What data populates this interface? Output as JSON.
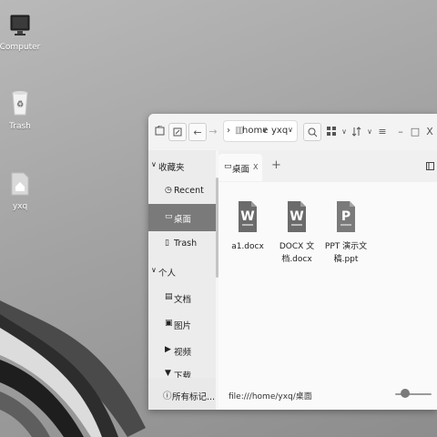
{
  "desktop": {
    "icons": [
      {
        "label": "Computer",
        "icon": "computer-icon"
      },
      {
        "label": "Trash",
        "icon": "trash-icon"
      },
      {
        "label": "yxq",
        "icon": "home-folder-icon"
      }
    ]
  },
  "window": {
    "path": {
      "home": "home",
      "yxq": "yxq"
    },
    "tab": {
      "label": "桌面",
      "close": "X",
      "new": "+"
    },
    "controls": {
      "menu": "≡",
      "minimize": "–",
      "maximize": "□",
      "close": "X"
    },
    "sidebar": {
      "sections": [
        {
          "label": "收藏夹",
          "items": [
            "Recent",
            "桌面",
            "Trash"
          ]
        },
        {
          "label": "个人",
          "items": [
            "文档",
            "图片",
            "视频",
            "下载"
          ]
        }
      ],
      "active_item": "桌面",
      "bottom": "所有标记..."
    },
    "files": [
      {
        "name": "a1.docx",
        "type": "word-doc-icon",
        "letter": "W"
      },
      {
        "name": "DOCX 文档.docx",
        "line1": "DOCX 文",
        "line2": "档.docx",
        "type": "word-doc-icon",
        "letter": "W"
      },
      {
        "name": "PPT 演示文稿.ppt",
        "line1": "PPT 演示文",
        "line2": "稿.ppt",
        "type": "ppt-doc-icon",
        "letter": "P"
      }
    ],
    "status": {
      "path": "file:///home/yxq/桌面"
    }
  }
}
